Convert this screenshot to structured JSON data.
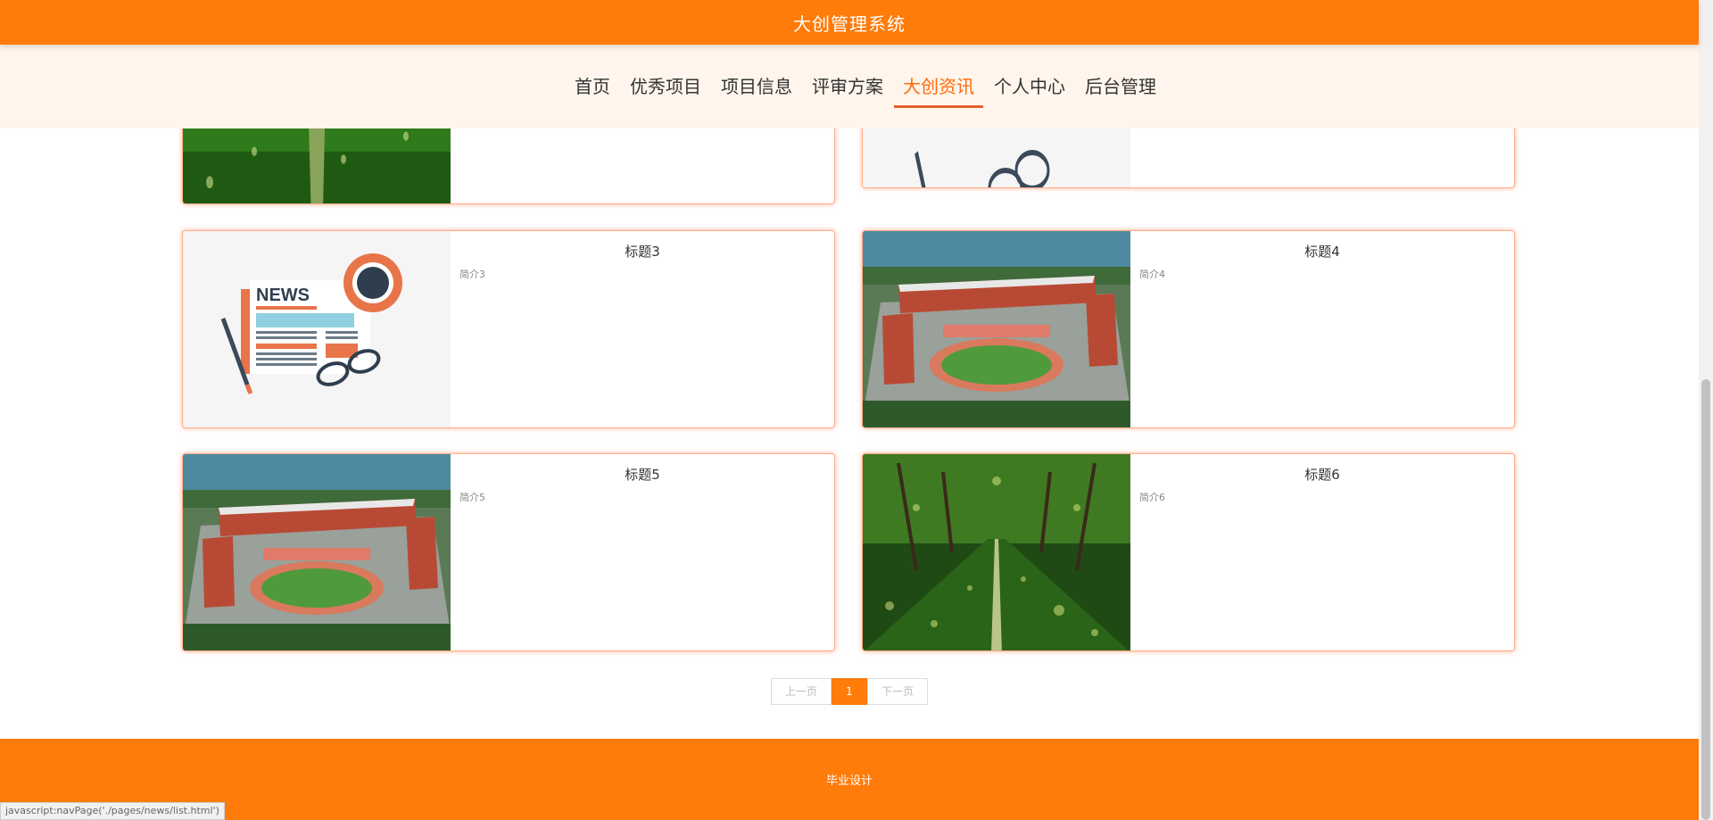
{
  "header": {
    "title": "大创管理系统"
  },
  "nav": {
    "items": [
      {
        "label": "首页"
      },
      {
        "label": "优秀项目"
      },
      {
        "label": "项目信息"
      },
      {
        "label": "评审方案"
      },
      {
        "label": "大创资讯",
        "active": true
      },
      {
        "label": "个人中心"
      },
      {
        "label": "后台管理"
      }
    ]
  },
  "news": [
    {
      "title": "标题3",
      "summary": "简介3",
      "image": "news-illustration"
    },
    {
      "title": "标题4",
      "summary": "简介4",
      "image": "campus-aerial"
    },
    {
      "title": "标题5",
      "summary": "简介5",
      "image": "campus-aerial"
    },
    {
      "title": "标题6",
      "summary": "简介6",
      "image": "tree-lined-road"
    }
  ],
  "pagination": {
    "prev": "上一页",
    "current": "1",
    "next": "下一页"
  },
  "footer": {
    "text": "毕业设计"
  },
  "status_bar": {
    "url": "javascript:navPage('./pages/news/list.html')"
  },
  "colors": {
    "accent": "#ff7b0a",
    "nav_bg": "#fff5ec",
    "card_border": "#ffab86"
  }
}
